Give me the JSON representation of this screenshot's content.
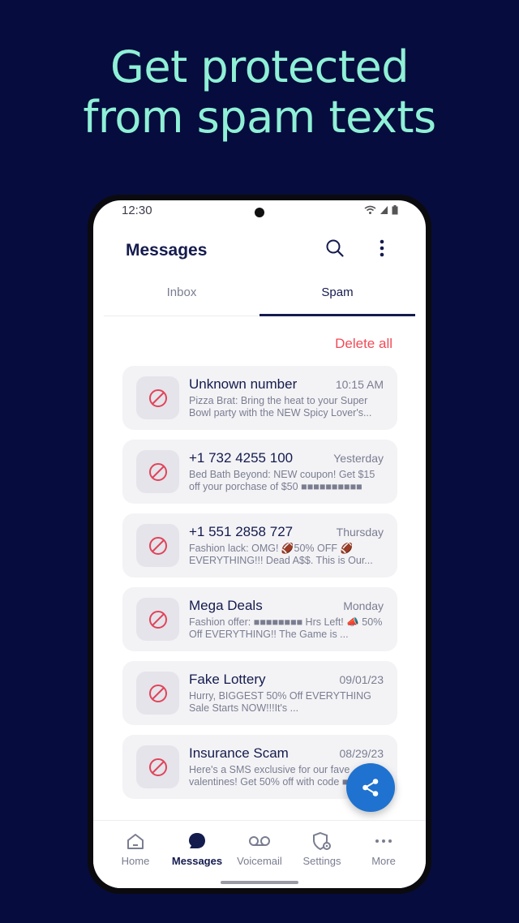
{
  "headline": {
    "line1": "Get protected",
    "line2": "from spam texts"
  },
  "status": {
    "time": "12:30"
  },
  "appbar": {
    "title": "Messages",
    "search_icon": "search-icon",
    "menu_icon": "more-vert-icon"
  },
  "tabs": [
    {
      "label": "Inbox",
      "active": false
    },
    {
      "label": "Spam",
      "active": true
    }
  ],
  "actions": {
    "delete_all": "Delete all"
  },
  "messages": [
    {
      "name": "Unknown number",
      "time": "10:15 AM",
      "snippet": "Pizza Brat: Bring the heat to your Super Bowl party with the NEW Spicy Lover's..."
    },
    {
      "name": "+1 732 4255 100",
      "time": "Yesterday",
      "snippet": "Bed Bath Beyond: NEW coupon! Get $15 off your porchase of $50 ■■■■■■■■■■"
    },
    {
      "name": "+1 551 2858 727",
      "time": "Thursday",
      "snippet": "Fashion lack: OMG! 🏈50% OFF 🏈 EVERYTHING!!! Dead A$$. This is Our..."
    },
    {
      "name": "Mega Deals",
      "time": "Monday",
      "snippet": "Fashion offer: ■■■■■■■■ Hrs Left! 📣 50% Off EVERYTHING!! The Game is ..."
    },
    {
      "name": "Fake Lottery",
      "time": "09/01/23",
      "snippet": "Hurry, BIGGEST 50% Off EVERYTHING Sale Starts NOW!!!It's ..."
    },
    {
      "name": "Insurance Scam",
      "time": "08/29/23",
      "snippet": "Here's a SMS exclusive for our fave valentines! Get 50% off with code ■■"
    }
  ],
  "fab": {
    "icon": "share-icon"
  },
  "bottom_nav": [
    {
      "label": "Home",
      "icon": "home-icon",
      "active": false
    },
    {
      "label": "Messages",
      "icon": "chat-bubble-icon",
      "active": true
    },
    {
      "label": "Voicemail",
      "icon": "voicemail-icon",
      "active": false
    },
    {
      "label": "Settings",
      "icon": "shield-gear-icon",
      "active": false
    },
    {
      "label": "More",
      "icon": "more-horiz-icon",
      "active": false
    }
  ],
  "colors": {
    "background": "#060c3d",
    "headline": "#8ff0d6",
    "accent_red": "#f04b57",
    "fab_blue": "#1f72cf",
    "navy": "#141b4d"
  }
}
